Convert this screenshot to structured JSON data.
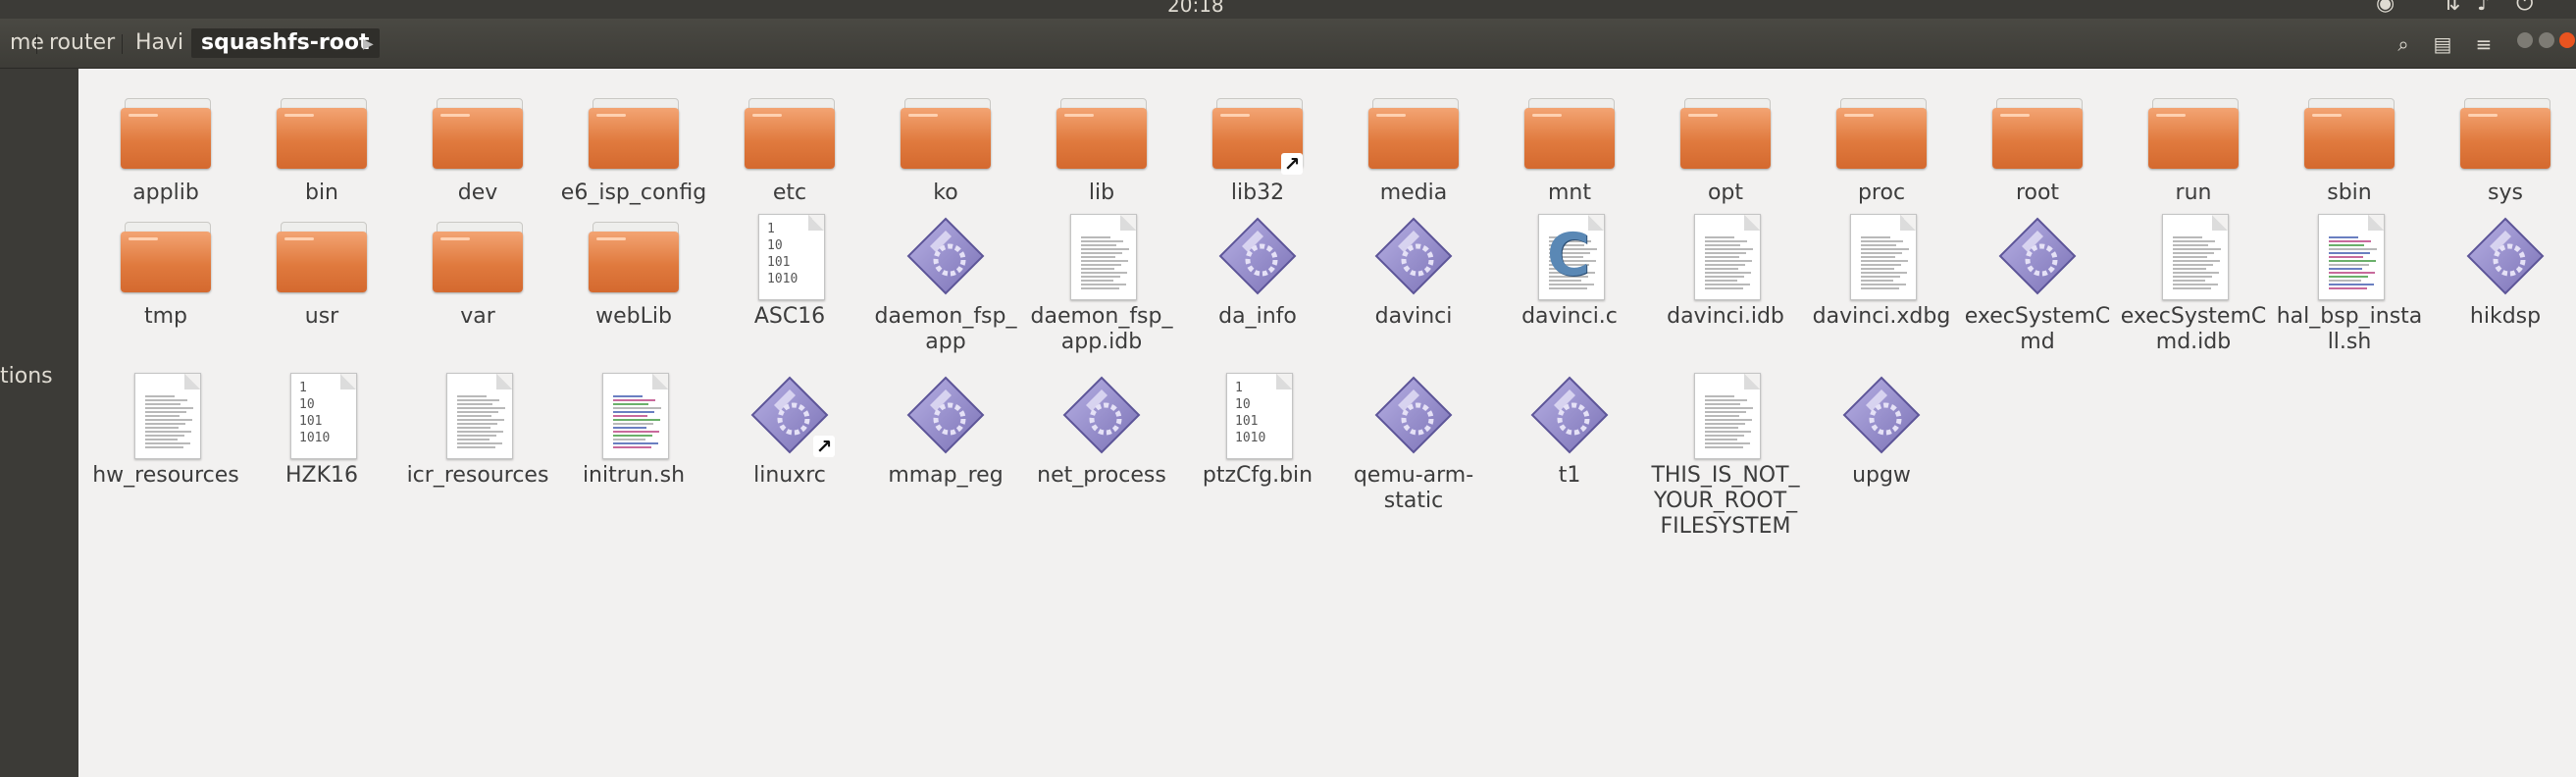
{
  "topbar": {
    "clock": "20:18"
  },
  "toolbar": {
    "crumbs": [
      "me",
      "router",
      "Havi",
      "squashfs-root"
    ]
  },
  "sidebar": {
    "partial_label": "tions"
  },
  "files": [
    {
      "name": "applib",
      "type": "folder"
    },
    {
      "name": "bin",
      "type": "folder"
    },
    {
      "name": "dev",
      "type": "folder"
    },
    {
      "name": "e6_isp_config",
      "type": "folder"
    },
    {
      "name": "etc",
      "type": "folder"
    },
    {
      "name": "ko",
      "type": "folder"
    },
    {
      "name": "lib",
      "type": "folder"
    },
    {
      "name": "lib32",
      "type": "folder-link"
    },
    {
      "name": "media",
      "type": "folder"
    },
    {
      "name": "mnt",
      "type": "folder"
    },
    {
      "name": "opt",
      "type": "folder"
    },
    {
      "name": "proc",
      "type": "folder"
    },
    {
      "name": "root",
      "type": "folder"
    },
    {
      "name": "run",
      "type": "folder"
    },
    {
      "name": "sbin",
      "type": "folder"
    },
    {
      "name": "sys",
      "type": "folder"
    },
    {
      "name": "tmp",
      "type": "folder"
    },
    {
      "name": "usr",
      "type": "folder"
    },
    {
      "name": "var",
      "type": "folder"
    },
    {
      "name": "webLib",
      "type": "folder"
    },
    {
      "name": "ASC16",
      "type": "binary"
    },
    {
      "name": "daemon_fsp_app",
      "type": "exec"
    },
    {
      "name": "daemon_fsp_app.idb",
      "type": "text"
    },
    {
      "name": "da_info",
      "type": "exec"
    },
    {
      "name": "davinci",
      "type": "exec"
    },
    {
      "name": "davinci.c",
      "type": "c-source"
    },
    {
      "name": "davinci.idb",
      "type": "text"
    },
    {
      "name": "davinci.xdbg",
      "type": "text"
    },
    {
      "name": "execSystemCmd",
      "type": "exec"
    },
    {
      "name": "execSystemCmd.idb",
      "type": "text"
    },
    {
      "name": "hal_bsp_install.sh",
      "type": "script"
    },
    {
      "name": "hikdsp",
      "type": "exec"
    },
    {
      "name": "hw_resources",
      "type": "text"
    },
    {
      "name": "HZK16",
      "type": "binary"
    },
    {
      "name": "icr_resources",
      "type": "text"
    },
    {
      "name": "initrun.sh",
      "type": "script"
    },
    {
      "name": "linuxrc",
      "type": "exec-link"
    },
    {
      "name": "mmap_reg",
      "type": "exec"
    },
    {
      "name": "net_process",
      "type": "exec"
    },
    {
      "name": "ptzCfg.bin",
      "type": "binary"
    },
    {
      "name": "qemu-arm-static",
      "type": "exec"
    },
    {
      "name": "t1",
      "type": "exec"
    },
    {
      "name": "THIS_IS_NOT_YOUR_ROOT_FILESYSTEM",
      "type": "text"
    },
    {
      "name": "upgw",
      "type": "exec"
    }
  ],
  "binary_glyph": [
    "1",
    "10",
    "101",
    "1010"
  ],
  "icons": {
    "search": "search-icon",
    "view": "view-toggle-icon",
    "menu": "menu-icon"
  },
  "colors": {
    "folder": "#e07a3e",
    "exec": "#8f86c9",
    "topbar": "#3c3b37"
  }
}
